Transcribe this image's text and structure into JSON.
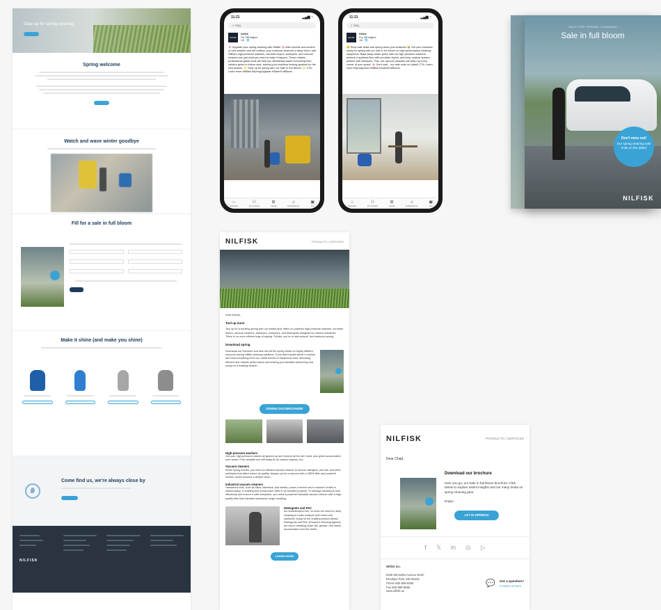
{
  "landing": {
    "hero_title": "Gear up for spring cleaning",
    "sec1_title": "Spring welcome",
    "sec2_title": "Watch and wave winter goodbye",
    "sec3_title": "Fill for a sale in full bloom",
    "sec4_title": "Make it shine (and make you shine)",
    "sec5_title": "Come find us, we're always close by"
  },
  "phone1": {
    "time": "11:21",
    "search": "Søg",
    "account": "Nilfisk",
    "meta1": "Fra 788 følgere",
    "meta2": "10t · 🌐",
    "post": "🌸 Upgrade your spring cleaning with Nilfisk! 🌸 After months and months of cold weather and dirt buildup, your business deserves a deep clean, and Nilfisk's high-pressure washers, scrubber dryers, sweepers, and vacuum cleaners are just what you need to make it happen. These reliable, professional-grade tools will help you effortlessly tackle everything from outdoor grime to indoor dust, leaving your business looking spotless for the new season. 🌟 Gear up for spring with our Sale in Full Bloom. 🌟 CTA: Learn more #Nilfisk #SpringUpgrade #SaleInFullBloom"
  },
  "phone2": {
    "time": "11:21",
    "search": "Søg",
    "account": "Nilfisk",
    "meta1": "Fra 788 følgere",
    "meta2": "10t · 🌐",
    "post": "🌼 Shop sale deals and spring clean your business 🐝 Get your business ready for spring with our sale in full bloom on high-performance cleaning equipment. Blast away winter grime with our high-pressure washers, achieve a spotless floor with scrubber dryers, and keep outdoor spaces pristine with sweepers. Plus, our vacuum cleaners will clean up every corner of your space. 🌸 Don't wait – our sale ends on (date)! CTA: Learn more #SpringClean #Nilfisk #SaleInFullBloom"
  },
  "phone_nav": [
    "Startside",
    "Dit netværk",
    "Opslå",
    "Notifikationer",
    "Job"
  ],
  "print": {
    "kicker": "SALE FOR SPRING CLEANING",
    "title": "Sale in full bloom",
    "badge_title": "Don't miss out!",
    "badge_text": "Our spring cleaning sale ends on the (date)",
    "logo": "NILFISK"
  },
  "email1": {
    "logo": "NILFISK",
    "nav": "PRODUCTS  |  SERVICES",
    "greeting": "Dear friends,",
    "h1": "Tool up more",
    "p1": "Tool up for a bursting spring with our limited-time offers on powerful high-pressure washers, scrubber dryers, vacuum cleaners, sweepers, extractors, and detergents designed for various industries. There is no more efficient way of saying: \"Winter, you're no last season\" and welcome spring.",
    "h2": "Download spring",
    "p2": "Download our brochure and dive into all the spring treats on highly efficient, resource-saving Nilfisk cleaning solutions. Good that'll tackle winter's residue and beat everything from non-metal threats to hazardous dust, delivering efficient and reliable performance and leaving your facilities welcoming and ready for a bustling season.",
    "cta1": "DOWNLOAD BROCHURE",
    "l1h": "High-pressure washers",
    "l1t": "Get your high-pressure washer all geared up and remove all the dirt, mold, and grime accumulated over winter! This versatile tool will easily fix all outdoor spaces, too.",
    "l2h": "Vacuum cleaners",
    "l2t": "When spring arrives, you need an efficient vacuum cleaner to remove allergens, pet hair, and other pollutants that affect indoor air quality. Always opt for a vacuum with a HEPA filter and powerful suction, which ensures a deeper clean.",
    "l3h": "Industrial vacuum cleaners",
    "l3t": "Hazardous dust, such as silica, asbestos, and metals, poses a severe risk to workers' health in warehousing, in building and construction sites if not handled properly. To manage hazardous dust effectively and ensure a safe workplace, you need a powerful industrial vacuum cleaner with a high-quality filter that tolerates somewhat rough handling.",
    "l4h": "Detergents and PAC",
    "l4t": "As housekeepers like, so does the need for deep cleaning to make surfaces both clean and sanitized; ready for the bustling season ahead. Detergents and PAC (Powerful Cleaning Agents) are key to breaking down dirt, grease, and stains accumulated over the winter.",
    "cta2": "LEARN MORE"
  },
  "email2": {
    "logo": "NILFISK",
    "nav": "PRODUCTS  |  SERVICES",
    "greeting": "Dear Chad,",
    "h": "Download our brochure",
    "p": "Here you go, our Sale in full bloom brochure. Click below to explore useful insights and our many treats on spring cleaning gear.",
    "sign": "Enjoy!",
    "cta": "LET IN SPRINGS",
    "company": "Nilfisk Inc.",
    "addr1": "9435 Winnetka Avenue North",
    "addr2": "Brooklyn Park, MN 55445",
    "addr3": "Phone 800-959-5555",
    "addr4": "Fax 800-989-9566",
    "addr5": "www.nilfisk.us",
    "q1": "Got a question?",
    "q2": "Contact us here"
  },
  "colors": {
    "accent": "#3aa3d6",
    "navy": "#1f3b5a",
    "footer": "#2a3441"
  }
}
